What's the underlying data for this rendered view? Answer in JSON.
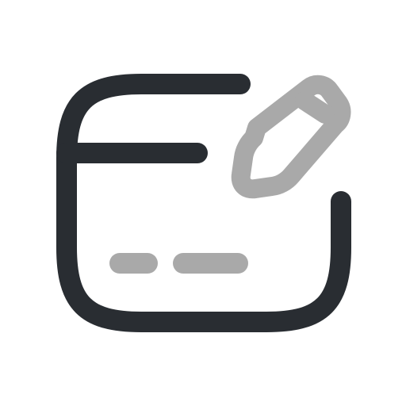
{
  "icon": {
    "name": "card-edit-icon",
    "colors": {
      "primary": "#292D32",
      "secondary": "#A9A9A9"
    }
  }
}
